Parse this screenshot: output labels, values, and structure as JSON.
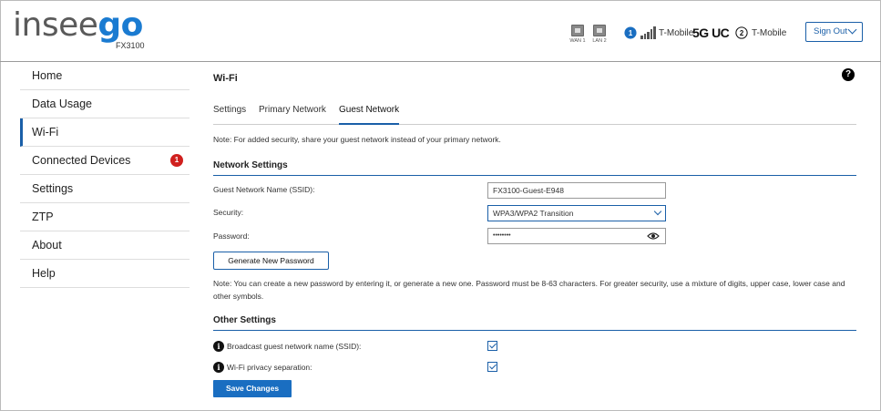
{
  "brand": {
    "logo_part1": "insee",
    "logo_part2": "go",
    "model": "FX3100"
  },
  "status": {
    "ports": [
      {
        "label": "WAN 1"
      },
      {
        "label": "LAN 2"
      }
    ],
    "sim1": {
      "number": "1",
      "carrier": "T-Mobile",
      "network": "5G UC"
    },
    "sim2": {
      "number": "2",
      "carrier": "T-Mobile"
    }
  },
  "header": {
    "signout_label": "Sign Out"
  },
  "sidebar": {
    "items": [
      {
        "label": "Home"
      },
      {
        "label": "Data Usage"
      },
      {
        "label": "Wi-Fi",
        "active": true
      },
      {
        "label": "Connected Devices",
        "badge": "1"
      },
      {
        "label": "Settings"
      },
      {
        "label": "ZTP"
      },
      {
        "label": "About"
      },
      {
        "label": "Help"
      }
    ]
  },
  "main": {
    "title": "Wi-Fi",
    "help_glyph": "?",
    "tabs": [
      {
        "label": "Settings"
      },
      {
        "label": "Primary Network"
      },
      {
        "label": "Guest Network",
        "active": true
      }
    ],
    "note_top": "Note: For added security, share your guest network instead of your primary network.",
    "network_settings": {
      "title": "Network Settings",
      "ssid_label": "Guest Network Name (SSID):",
      "ssid_value": "FX3100-Guest-E948",
      "security_label": "Security:",
      "security_value": "WPA3/WPA2 Transition",
      "password_label": "Password:",
      "password_value": "••••••••",
      "generate_label": "Generate New Password",
      "note": "Note: You can create a new password by entering it, or generate a new one. Password must be 8-63 characters. For greater security, use a mixture of digits, upper case, lower case and other symbols."
    },
    "other_settings": {
      "title": "Other Settings",
      "info_glyph": "i",
      "broadcast_label": "Broadcast guest network name (SSID):",
      "broadcast_checked": true,
      "privacy_label": "Wi-Fi privacy separation:",
      "privacy_checked": true
    },
    "save_label": "Save Changes"
  },
  "colors": {
    "brand_blue": "#1a7bd1",
    "accent": "#1a5fa8",
    "badge_red": "#d0201e",
    "button_blue": "#1a6ec1"
  }
}
